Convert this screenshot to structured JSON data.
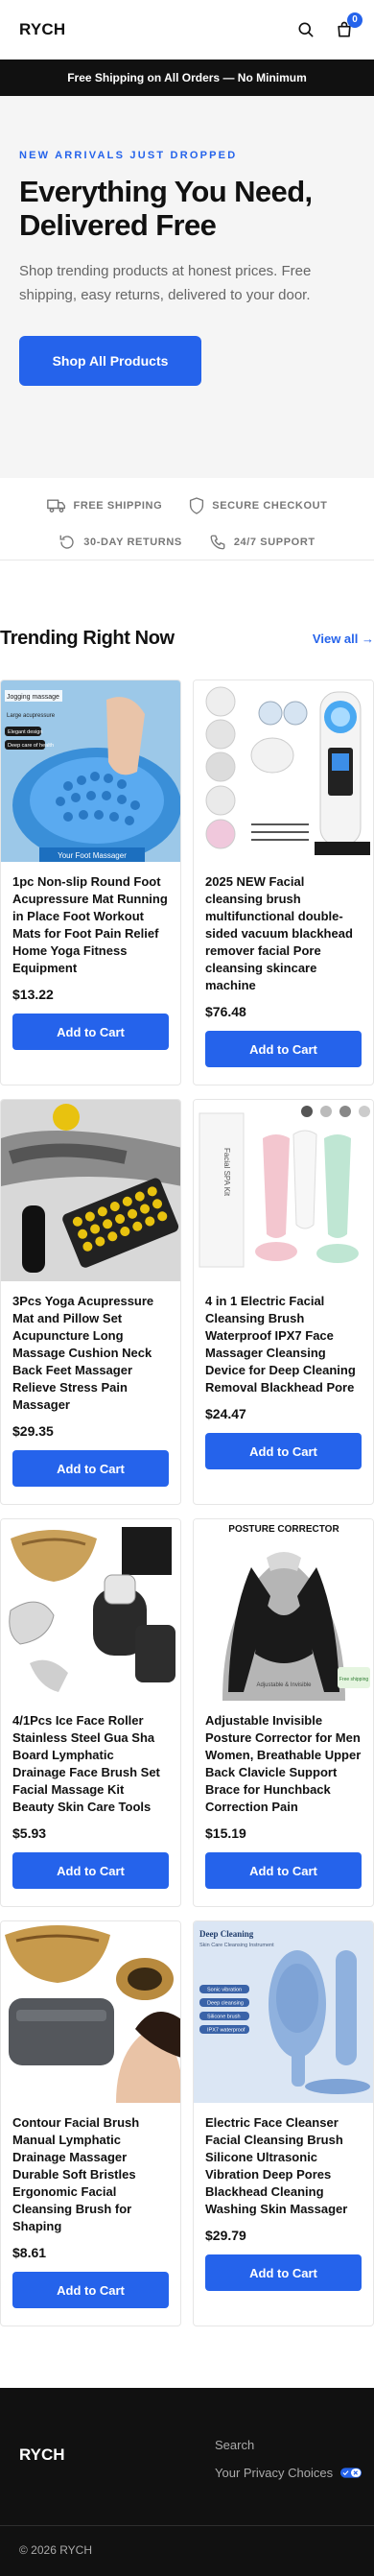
{
  "header": {
    "logo": "RYCH",
    "search_icon": "search-icon",
    "cart_icon": "shopping-bag-icon",
    "cart_count": "0"
  },
  "announcement": "Free Shipping on All Orders — No Minimum",
  "hero": {
    "eyebrow": "New Arrivals Just Dropped",
    "title": "Everything You Need, Delivered Free",
    "subtitle": "Shop trending products at honest prices. Free shipping, easy returns, delivered to your door.",
    "cta_label": "Shop All Products"
  },
  "trust": [
    {
      "icon": "truck-icon",
      "label": "Free Shipping"
    },
    {
      "icon": "shield-icon",
      "label": "Secure Checkout"
    },
    {
      "icon": "return-arrow-icon",
      "label": "30-Day Returns"
    },
    {
      "icon": "phone-icon",
      "label": "24/7 Support"
    }
  ],
  "trending": {
    "title": "Trending Right Now",
    "view_all": "View all →",
    "add_label": "Add to Cart",
    "products": [
      {
        "title": "1pc Non-slip Round Foot Acupressure Mat Running in Place Foot Workout Mats for Foot Pain Relief Home Yoga Fitness Equipment",
        "price": "$13.22",
        "img_texts": [
          "Jogging massage",
          "Large acupressure",
          "Elegant design",
          "Deep care of health",
          "Your Foot Massager"
        ]
      },
      {
        "title": "2025 NEW Facial cleansing brush multifunctional double-sided vacuum blackhead remover facial Pore cleansing skincare machine",
        "price": "$76.48",
        "img_texts": []
      },
      {
        "title": "3Pcs Yoga Acupressure Mat and Pillow Set Acupuncture Long Massage Cushion Neck Back Feet Massager Relieve Stress Pain Massager",
        "price": "$29.35",
        "img_texts": []
      },
      {
        "title": "4 in 1 Electric Facial Cleansing Brush Waterproof IPX7 Face Massager Cleansing Device for Deep Cleaning Removal Blackhead Pore",
        "price": "$24.47",
        "img_texts": [
          "Facial SPA Kit"
        ]
      },
      {
        "title": "4/1Pcs Ice Face Roller Stainless Steel Gua Sha Board Lymphatic Drainage Face Brush Set Facial Massage Kit Beauty Skin Care Tools",
        "price": "$5.93",
        "img_texts": []
      },
      {
        "title": "Adjustable Invisible Posture Corrector for Men Women, Breathable Upper Back Clavicle Support Brace for Hunchback Correction Pain",
        "price": "$15.19",
        "img_texts": [
          "POSTURE CORRECTOR",
          "Adjustable & Invisible",
          "Free shipping"
        ]
      },
      {
        "title": "Contour Facial Brush Manual Lymphatic Drainage Massager Durable Soft Bristles Ergonomic Facial Cleansing Brush for Shaping",
        "price": "$8.61",
        "img_texts": []
      },
      {
        "title": "Electric Face Cleanser Facial Cleansing Brush Silicone Ultrasonic Vibration Deep Pores Blackhead Cleaning Washing Skin Massager",
        "price": "$29.79",
        "img_texts": [
          "Deep Cleaning",
          "Skin Care Cleansing Instrument",
          "Sonic vibration",
          "Deep cleansing",
          "Silicone brush",
          "IPX7 waterproof"
        ]
      }
    ]
  },
  "footer": {
    "logo": "RYCH",
    "links": [
      "Search",
      "Your Privacy Choices"
    ],
    "privacy_icon": "privacy-toggle-icon",
    "copyright": "© 2026 RYCH"
  },
  "colors": {
    "accent": "#2563eb",
    "dark": "#111111",
    "muted": "#777777",
    "hero_bg": "#f5f5f5"
  }
}
